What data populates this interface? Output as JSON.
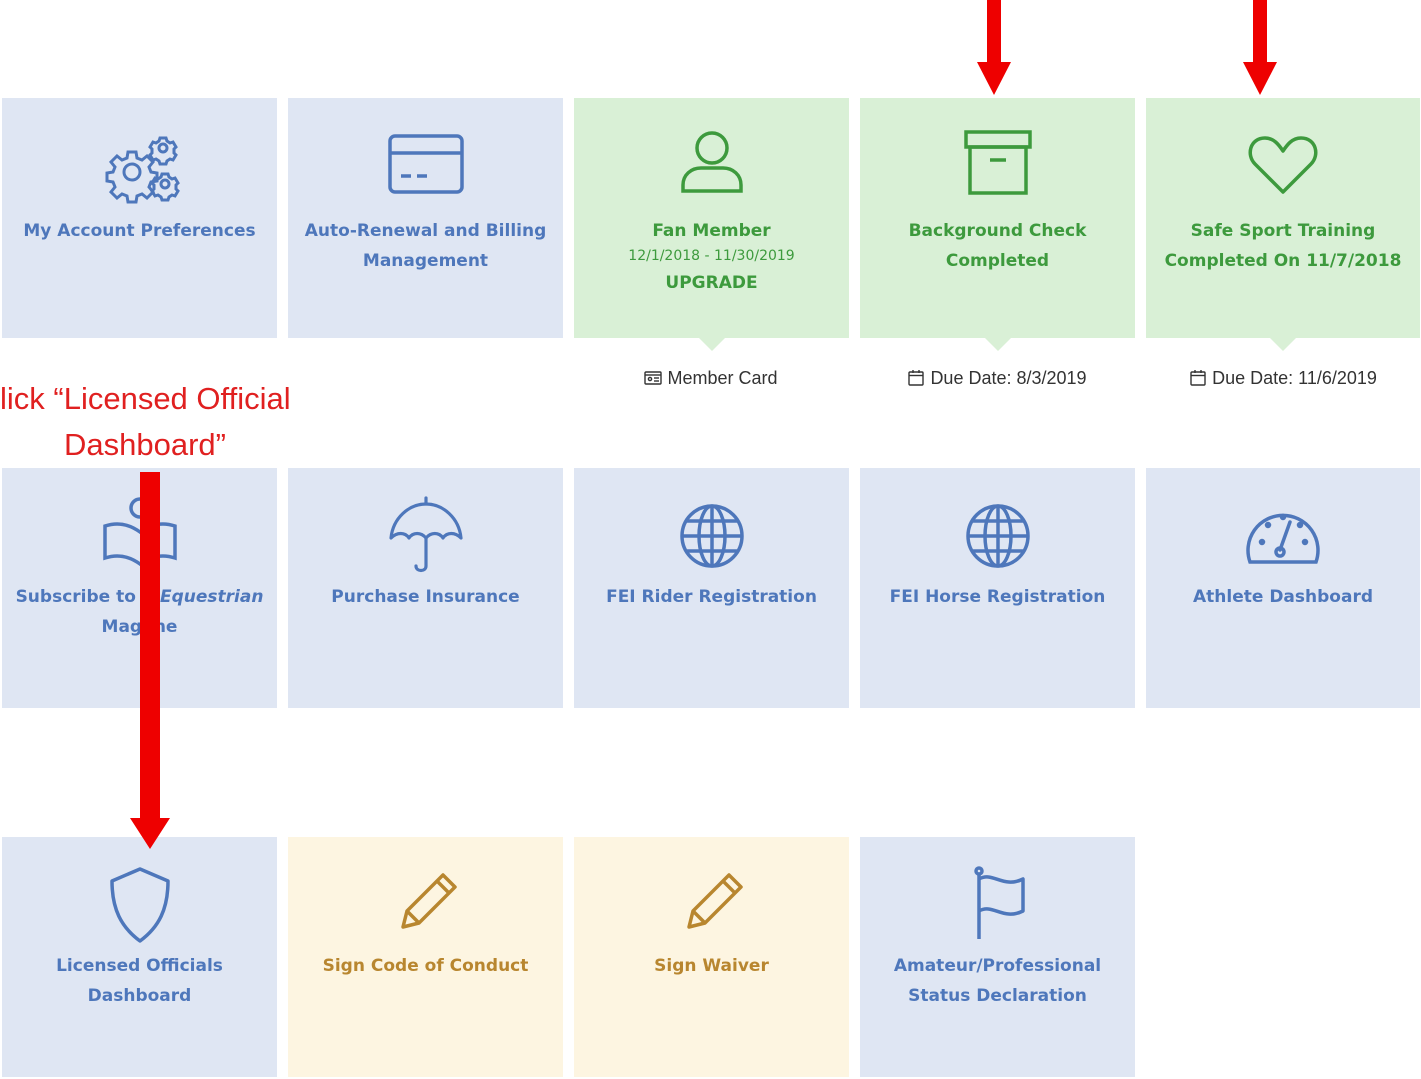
{
  "callout": {
    "line1": "lick “Licensed Official",
    "line2": "Dashboard”"
  },
  "colors": {
    "blue_tile": "#dfe6f3",
    "blue_text": "#4e77bb",
    "green_tile": "#d9f0d6",
    "green_text": "#3d9a3d",
    "cream_tile": "#fdf5e1",
    "cream_text": "#b8862f",
    "arrow": "#ee0000"
  },
  "tiles": {
    "account_prefs": {
      "label": "My Account Preferences",
      "icon": "gears-icon"
    },
    "auto_renewal": {
      "label1": "Auto-Renewal and Billing",
      "label2": "Management",
      "icon": "credit-card-icon"
    },
    "fan_member": {
      "label": "Fan Member",
      "dates": "12/1/2018 - 11/30/2019",
      "upgrade": "UPGRADE",
      "below": "Member Card",
      "icon": "user-icon"
    },
    "background_check": {
      "label1": "Background Check",
      "label2": "Completed",
      "below": "Due Date: 8/3/2019",
      "icon": "archive-box-icon"
    },
    "safe_sport": {
      "label1": "Safe Sport Training",
      "label2": "Completed On 11/7/2018",
      "below": "Due Date: 11/6/2019",
      "icon": "heart-icon"
    },
    "subscribe": {
      "label_prefix": "Subscribe to ",
      "label_italic": "S Equestrian",
      "label2": "Mag ine",
      "icon": "reading-icon"
    },
    "insurance": {
      "label": "Purchase Insurance",
      "icon": "umbrella-icon"
    },
    "fei_rider": {
      "label": "FEI Rider Registration",
      "icon": "globe-icon"
    },
    "fei_horse": {
      "label": "FEI Horse Registration",
      "icon": "globe-icon"
    },
    "athlete": {
      "label": "Athlete Dashboard",
      "icon": "speedometer-icon"
    },
    "licensed_officials": {
      "label1": "Licensed Officials",
      "label2": "Dashboard",
      "icon": "shield-icon"
    },
    "code_of_conduct": {
      "label": "Sign Code of Conduct",
      "icon": "pencil-icon"
    },
    "waiver": {
      "label": "Sign Waiver",
      "icon": "pencil-icon"
    },
    "amateur": {
      "label1": "Amateur/Professional",
      "label2": "Status Declaration",
      "icon": "flag-icon"
    }
  }
}
